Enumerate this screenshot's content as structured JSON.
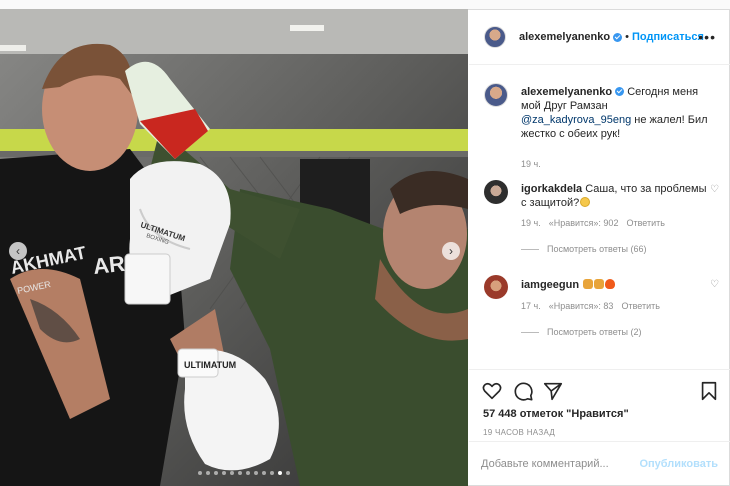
{
  "post": {
    "author": "alexemelyanenko",
    "follow_label": "Подписаться",
    "bullet": "•",
    "more_label": "•••",
    "caption": {
      "username": "alexemelyanenko",
      "text_before": "Сегодня меня мой Друг Рамзан ",
      "mention": "@za_kadyrova_95eng",
      "text_after": " не жалел! Бил жестко с обеих рук!",
      "time": "19 ч."
    },
    "comments": [
      {
        "username": "igorkakdela",
        "text": "Саша, что за проблемы с защитой?",
        "time": "19 ч.",
        "likes": "«Нравится»: 902",
        "reply_label": "Ответить",
        "view_replies": "Посмотреть ответы (66)"
      },
      {
        "username": "iamgeegun",
        "text": "",
        "time": "17 ч.",
        "likes": "«Нравится»: 83",
        "reply_label": "Ответить",
        "view_replies": "Посмотреть ответы (2)"
      }
    ],
    "likes_count": "57 448 отметок \"Нравится\"",
    "time_ago": "19 ЧАСОВ НАЗАД",
    "comment_placeholder": "Добавьте комментарий...",
    "publish_label": "Опубликовать",
    "carousel": {
      "total": 12,
      "active": 11
    },
    "photo_text": {
      "shirt_1": "AKHMAT",
      "shirt_2": "POWER",
      "glove_1": "ULTIMATUM",
      "glove_2": "BOXING",
      "shirt_3": "ARKHAT",
      "cuff": "ULTIMATUM"
    },
    "colors": {
      "link": "#00376b",
      "primary_blue": "#0095f6",
      "publish_disabled": "#b2dffc",
      "text": "#262626",
      "muted": "#8e8e8e",
      "accent_green": "#c7d84a"
    }
  }
}
